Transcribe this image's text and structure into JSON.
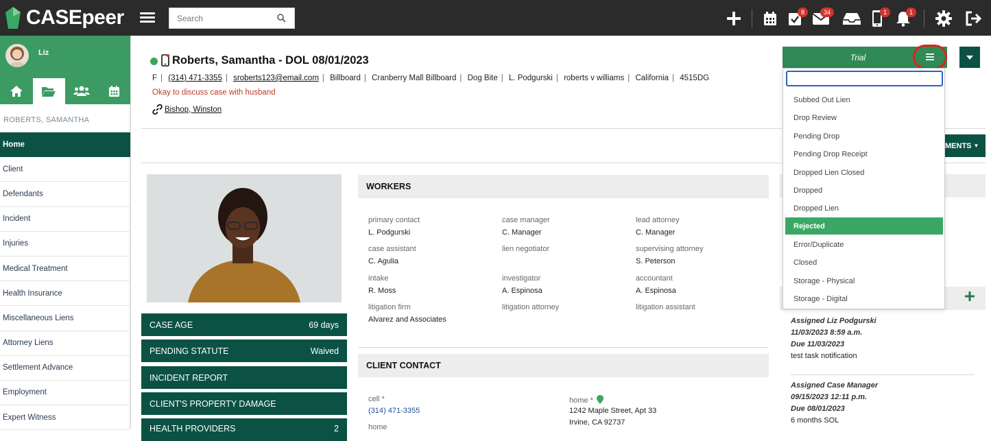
{
  "app": {
    "logo_text": "CASEpeer"
  },
  "topbar": {
    "search_placeholder": "Search",
    "badges": {
      "tasks": "8",
      "mail": "34",
      "phone": "1",
      "bell": "1"
    }
  },
  "sidebar": {
    "user_name": "Liz",
    "client_name": "ROBERTS, SAMANTHA",
    "items": [
      {
        "label": "Home"
      },
      {
        "label": "Client"
      },
      {
        "label": "Defendants"
      },
      {
        "label": "Incident"
      },
      {
        "label": "Injuries"
      },
      {
        "label": "Medical Treatment"
      },
      {
        "label": "Health Insurance"
      },
      {
        "label": "Miscellaneous Liens"
      },
      {
        "label": "Attorney Liens"
      },
      {
        "label": "Settlement Advance"
      },
      {
        "label": "Employment"
      },
      {
        "label": "Expert Witness"
      }
    ]
  },
  "case_header": {
    "title": "Roberts, Samantha - DOL 08/01/2023",
    "info": [
      "F",
      "(314) 471-3355",
      "sroberts123@email.com",
      "Billboard",
      "Cranberry Mall Billboard",
      "Dog Bite",
      "L. Podgurski",
      "roberts v williams",
      "California",
      "4515DG"
    ],
    "note": "Okay to discuss case with husband",
    "linked_contact": "Bishop, Winston"
  },
  "documents_button": "MENTS",
  "stats": [
    {
      "label": "CASE AGE",
      "value": "69 days"
    },
    {
      "label": "PENDING STATUTE",
      "value": "Waived"
    },
    {
      "label": "INCIDENT REPORT",
      "value": ""
    },
    {
      "label": "CLIENT'S PROPERTY DAMAGE",
      "value": ""
    },
    {
      "label": "HEALTH PROVIDERS",
      "value": "2"
    }
  ],
  "workers": {
    "title": "WORKERS",
    "cells": [
      {
        "label": "primary contact",
        "value": "L. Podgurski"
      },
      {
        "label": "case manager",
        "value": "C. Manager"
      },
      {
        "label": "lead attorney",
        "value": "C. Manager"
      },
      {
        "label": "case assistant",
        "value": "C. Agulia"
      },
      {
        "label": "lien negotiator",
        "value": ""
      },
      {
        "label": "supervising attorney",
        "value": "S. Peterson"
      },
      {
        "label": "intake",
        "value": "R. Moss"
      },
      {
        "label": "investigator",
        "value": "A. Espinosa"
      },
      {
        "label": "accountant",
        "value": "A. Espinosa"
      },
      {
        "label": "litigation firm",
        "value": "Alvarez and Associates"
      },
      {
        "label": "litigation attorney",
        "value": ""
      },
      {
        "label": "litigation assistant",
        "value": ""
      }
    ]
  },
  "client_contact": {
    "title": "CLIENT CONTACT",
    "cell_label": "cell *",
    "cell_value": "(314) 471-3355",
    "home_label": "home",
    "home_addr_label": "home *",
    "address_line1": "1242 Maple Street, Apt 33",
    "address_line2": "Irvine, CA 92737"
  },
  "tasks": [
    {
      "assigned": "Assigned Liz Podgurski",
      "date": "11/03/2023 8:59 a.m.",
      "due": "Due 11/03/2023",
      "name": "test task notification"
    },
    {
      "assigned": "Assigned Case Manager",
      "date": "09/15/2023 12:11 p.m.",
      "due": "Due 08/01/2023",
      "name": "6 months SOL"
    }
  ],
  "status": {
    "current": "Trial",
    "filter_value": "",
    "options": [
      {
        "label": "Subbed Out Lien",
        "selected": false
      },
      {
        "label": "Drop Review",
        "selected": false
      },
      {
        "label": "Pending Drop",
        "selected": false
      },
      {
        "label": "Pending Drop Receipt",
        "selected": false
      },
      {
        "label": "Dropped Lien Closed",
        "selected": false
      },
      {
        "label": "Dropped",
        "selected": false
      },
      {
        "label": "Dropped Lien",
        "selected": false
      },
      {
        "label": "Rejected",
        "selected": true
      },
      {
        "label": "Error/Duplicate",
        "selected": false
      },
      {
        "label": "Closed",
        "selected": false
      },
      {
        "label": "Storage - Physical",
        "selected": false
      },
      {
        "label": "Storage - Digital",
        "selected": false
      }
    ]
  },
  "colors": {
    "brand_green": "#3c9b63",
    "dark_green": "#0b5244",
    "selected_green": "#3aa864",
    "highlight_red": "#e0231b"
  }
}
